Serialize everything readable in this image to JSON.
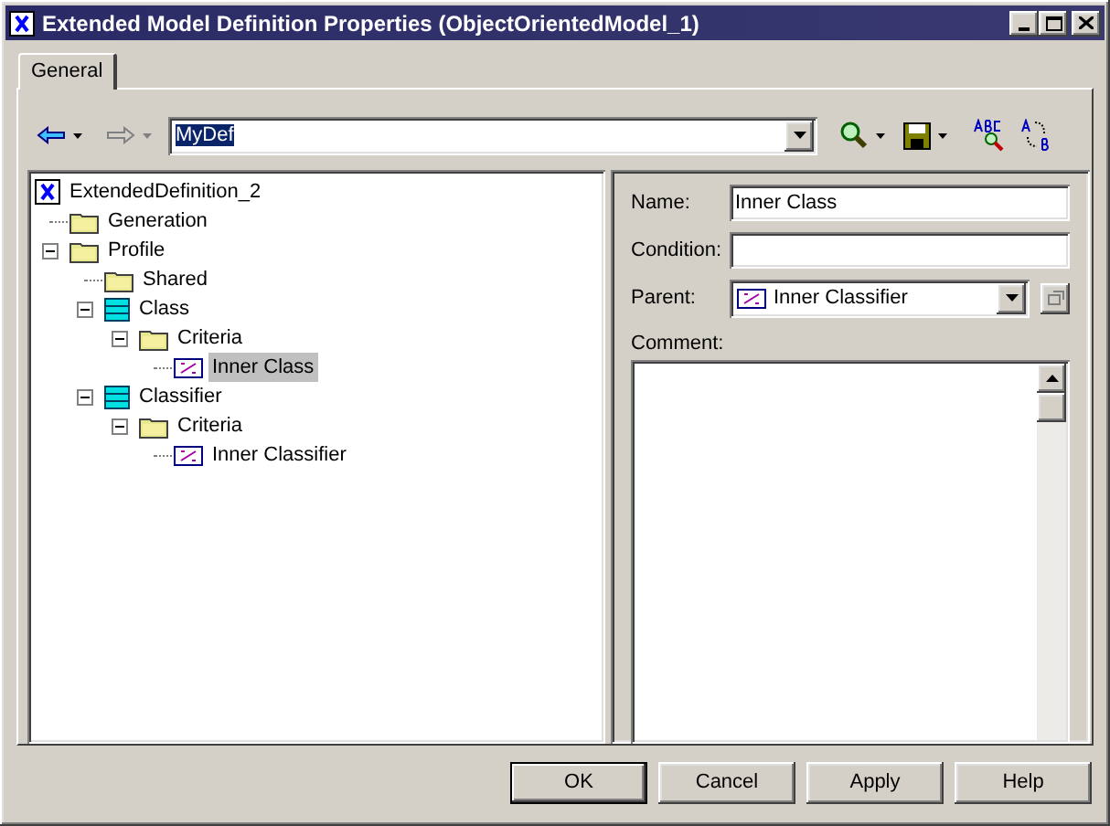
{
  "window": {
    "title": "Extended Model Definition Properties (ObjectOrientedModel_1)"
  },
  "tabs": [
    {
      "label": "General",
      "selected": true
    }
  ],
  "toolbar": {
    "back_disabled": false,
    "forward_disabled": true,
    "definition": {
      "value": "MyDef",
      "selected": true
    }
  },
  "tree": [
    {
      "label": "ExtendedDefinition_2",
      "kind": "model",
      "selected": false,
      "children": [
        {
          "label": "Generation",
          "kind": "folder",
          "selected": false
        },
        {
          "label": "Profile",
          "kind": "folder",
          "selected": false,
          "expanded": true,
          "children": [
            {
              "label": "Shared",
              "kind": "folder",
              "selected": false
            },
            {
              "label": "Class",
              "kind": "class",
              "selected": false,
              "expanded": true,
              "children": [
                {
                  "label": "Criteria",
                  "kind": "folder",
                  "selected": false,
                  "expanded": true,
                  "children": [
                    {
                      "label": "Inner Class",
                      "kind": "criterion",
                      "selected": true
                    }
                  ]
                }
              ]
            },
            {
              "label": "Classifier",
              "kind": "class",
              "selected": false,
              "expanded": true,
              "children": [
                {
                  "label": "Criteria",
                  "kind": "folder",
                  "selected": false,
                  "expanded": true,
                  "children": [
                    {
                      "label": "Inner Classifier",
                      "kind": "criterion",
                      "selected": false
                    }
                  ]
                }
              ]
            }
          ]
        }
      ]
    }
  ],
  "properties": {
    "name": {
      "label": "Name:",
      "value": "Inner Class"
    },
    "condition": {
      "label": "Condition:"
    },
    "parent": {
      "label": "Parent:",
      "value": "Inner Classifier",
      "kind": "criterion"
    },
    "comment": {
      "label": "Comment:"
    }
  },
  "buttons": [
    {
      "label": "OK",
      "default": true
    },
    {
      "label": "Cancel",
      "default": false
    },
    {
      "label": "Apply",
      "default": false
    },
    {
      "label": "Help",
      "default": false
    }
  ]
}
